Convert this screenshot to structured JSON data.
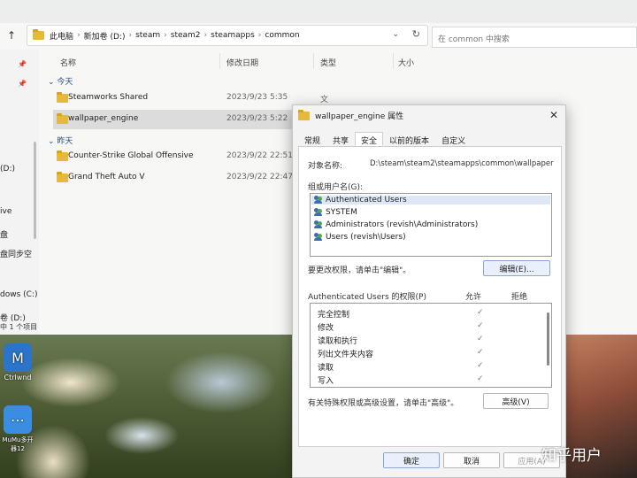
{
  "explorer": {
    "breadcrumb": [
      "此电脑",
      "新加卷 (D:)",
      "steam",
      "steam2",
      "steamapps",
      "common"
    ],
    "search_placeholder": "在 common 中搜索",
    "columns": [
      "名称",
      "修改日期",
      "类型",
      "大小"
    ],
    "groups": [
      {
        "label": "今天",
        "rows": [
          {
            "name": "Steamworks Shared",
            "date": "2023/9/23 5:35",
            "type": "文件夹"
          },
          {
            "name": "wallpaper_engine",
            "date": "2023/9/23 5:22",
            "type": "",
            "selected": true
          }
        ]
      },
      {
        "label": "昨天",
        "rows": [
          {
            "name": "Counter-Strike Global Offensive",
            "date": "2023/9/22 22:51",
            "type": ""
          },
          {
            "name": "Grand Theft Auto V",
            "date": "2023/9/22 22:47",
            "type": ""
          }
        ]
      }
    ],
    "left_pane": [
      "(D:)",
      "ive",
      "盘",
      "盘同步空",
      "dows (C:)",
      "卷 (D:)"
    ],
    "status": "中 1 个项目"
  },
  "desktop": {
    "icons": [
      {
        "label": "Ctrlwnd",
        "glyph": "M"
      },
      {
        "label": "MuMu多开器12",
        "glyph": "⋯"
      }
    ]
  },
  "dialog": {
    "title": "wallpaper_engine 属性",
    "tabs": [
      "常规",
      "共享",
      "安全",
      "以前的版本",
      "自定义"
    ],
    "active_tab": "安全",
    "object_label": "对象名称:",
    "object_value": "D:\\steam\\steam2\\steamapps\\common\\wallpaper",
    "groups_label": "组或用户名(G):",
    "users": [
      "Authenticated Users",
      "SYSTEM",
      "Administrators (revish\\Administrators)",
      "Users (revish\\Users)"
    ],
    "change_perm_text": "要更改权限，请单击\"编辑\"。",
    "edit_button": "编辑(E)...",
    "perm_header": "Authenticated Users 的权限(P)",
    "allow_label": "允许",
    "deny_label": "拒绝",
    "permissions": [
      {
        "name": "完全控制",
        "allow": true
      },
      {
        "name": "修改",
        "allow": true
      },
      {
        "name": "读取和执行",
        "allow": true
      },
      {
        "name": "列出文件夹内容",
        "allow": true
      },
      {
        "name": "读取",
        "allow": true
      },
      {
        "name": "写入",
        "allow": true
      }
    ],
    "advanced_text": "有关特殊权限或高级设置，请单击\"高级\"。",
    "advanced_button": "高级(V)",
    "ok_button": "确定",
    "cancel_button": "取消",
    "apply_button": "应用(A)",
    "check_glyph": "✓"
  },
  "watermark": "知乎用户"
}
